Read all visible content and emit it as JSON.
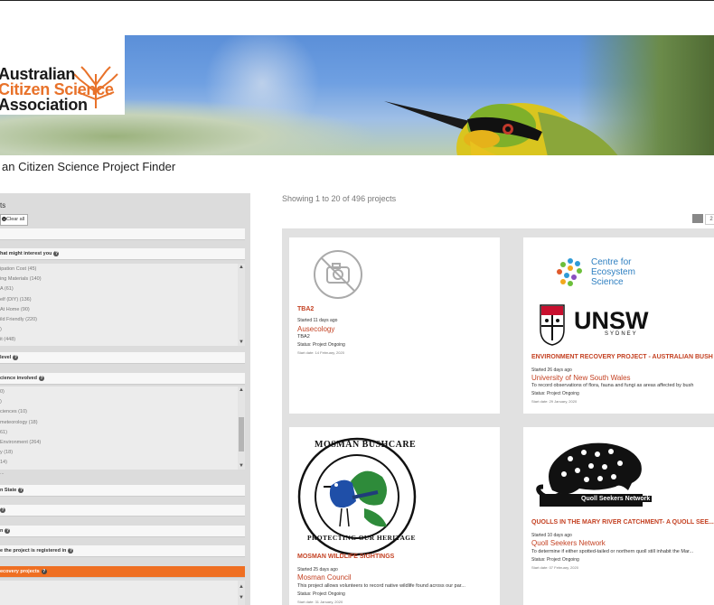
{
  "header": {
    "logo_line1": "Australian",
    "logo_line2": "Citizen Science",
    "logo_line3": "Association",
    "page_title": "an Citizen Science Project Finder"
  },
  "sidebar": {
    "heading": "ts",
    "clear_label": "Clear all",
    "interest_panel": "hat might interest you",
    "interest_items": [
      "ipation Cost (45)",
      "ing Materials (140)",
      "A (61)",
      "elf (DIY) (136)",
      " At Home (90)",
      "ild Friendly (220)",
      ")",
      "it (448)"
    ],
    "level_panel": "level",
    "science_panel": "cience involved",
    "science_items": [
      "0)",
      ")",
      "ciences (10)",
      "meteorology (18)",
      "61)",
      "Environment (264)",
      "y (18)",
      "14)",
      "..."
    ],
    "state_panel": "n State",
    "panel_q": "",
    "panel_n": "n",
    "registered_panel": "e the project is registered in",
    "recovery_panel": "ecovery projects",
    "recovery_items": [
      "",
      ""
    ]
  },
  "main": {
    "showing": "Showing 1 to 20 of 496 projects",
    "pager": [
      "",
      "2"
    ],
    "cards": [
      {
        "title": "TBA2",
        "started": "Started 11 days ago",
        "org": "Ausecology",
        "desc": "TBA2",
        "status": "Status: Project Ongoing",
        "date": "Start date: 14 February, 2020",
        "logo": "no-image"
      },
      {
        "title": "ENVIRONMENT RECOVERY PROJECT - AUSTRALIAN BUSH",
        "started": "Started 26 days ago",
        "org": "University of New South Wales",
        "desc": "To record observations of flora, fauna and fungi as areas affected by bush",
        "status": "Status: Project Ongoing",
        "date": "Start date: 29 January, 2020",
        "logo_line1": "Centre for",
        "logo_line2": "Ecosystem",
        "logo_line3": "Science",
        "logo_unsw": "UNSW",
        "logo_sydney": "SYDNEY"
      },
      {
        "title": "MOSMAN WILDLIFE SIGHTINGS",
        "started": "Started 25 days ago",
        "org": "Mosman Council",
        "desc": "This project allows volunteers to record native wildlife found across our par...",
        "status": "Status: Project Ongoing",
        "date": "Start date: 31 January, 2020",
        "logo_top": "MOSMAN BUSHCARE",
        "logo_bottom": "PROTECTING OUR HERITAGE"
      },
      {
        "title": "QUOLLS IN THE MARY RIVER CATCHMENT- A QUOLL SEE...",
        "started": "Started 10 days ago",
        "org": "Quoll Seekers Network",
        "desc": "To determine if either spotted-tailed or northern quoll still inhabit the Mar...",
        "status": "Status: Project Ongoing",
        "date": "Start date: 07 February, 2020",
        "logo_text": "Quoll Seekers Network"
      }
    ]
  },
  "colors": {
    "accent": "#ef6f22",
    "title_red": "#c44122",
    "sidebar_bg": "#dcdcdc"
  }
}
